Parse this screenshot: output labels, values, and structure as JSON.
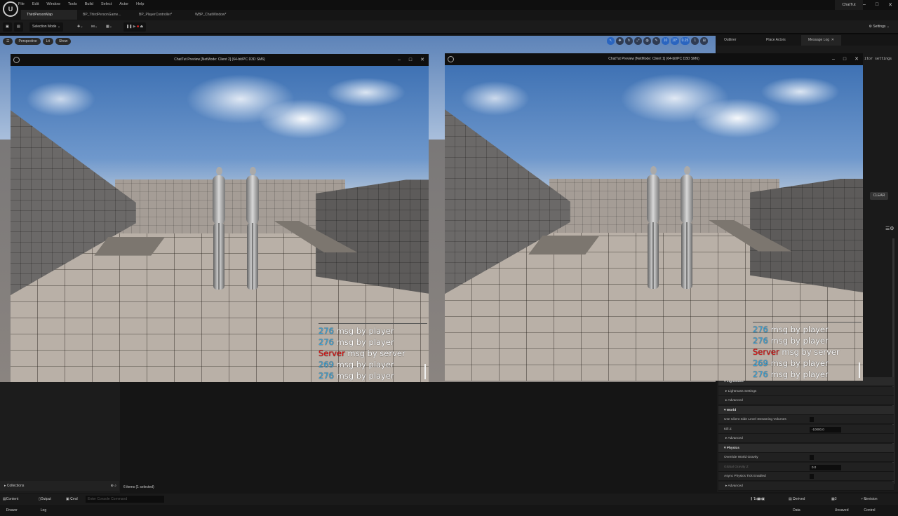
{
  "app": {
    "title": "ChatTut",
    "logo": "U"
  },
  "menu": [
    "File",
    "Edit",
    "Window",
    "Tools",
    "Build",
    "Select",
    "Actor",
    "Help"
  ],
  "tabs": [
    {
      "label": "ThirdPersonMap"
    },
    {
      "label": "BP_ThirdPersonGame..."
    },
    {
      "label": "BP_PlayerController*"
    },
    {
      "label": "WBP_ChatWindow*"
    }
  ],
  "toolbar": {
    "selection_mode": "Selection Mode",
    "settings": "Settings"
  },
  "viewport": {
    "view": "Perspective",
    "lit": "Lit",
    "show": "Show",
    "grid": "10",
    "angle": "10°",
    "scale": "0.25",
    "camera": "1"
  },
  "right_tabs": [
    "Outliner",
    "Place Actors",
    "Message Log"
  ],
  "right_panel": {
    "editor_settings": "itor settings",
    "clear": "CLEAR",
    "rows": [
      {
        "label": "Lightmass",
        "type": "cat"
      },
      {
        "label": "Lightmass Settings",
        "type": "sub"
      },
      {
        "label": "Advanced",
        "type": "sub"
      },
      {
        "label": "World",
        "type": "cat"
      },
      {
        "label": "Use Client Side Level Streaming Volumes",
        "type": "check"
      },
      {
        "label": "Kill Z",
        "type": "value",
        "value": "-10000.0"
      },
      {
        "label": "Advanced",
        "type": "sub"
      },
      {
        "label": "Physics",
        "type": "cat"
      },
      {
        "label": "Override World Gravity",
        "type": "check"
      },
      {
        "label": "Global Gravity Z",
        "type": "value",
        "value": "0.0",
        "disabled": true
      },
      {
        "label": "Async Physics Tick Enabled",
        "type": "check"
      },
      {
        "label": "Advanced",
        "type": "sub"
      }
    ]
  },
  "preview_windows": [
    {
      "title": "ChatTut Preview [NetMode: Client 2]  (64-bit/PC D3D SM6)"
    },
    {
      "title": "ChatTut Preview [NetMode: Client 1]  (64-bit/PC D3D SM6)"
    }
  ],
  "chat": [
    {
      "name": "276",
      "msg": "msg by player",
      "kind": "player"
    },
    {
      "name": "276",
      "msg": "msg by player",
      "kind": "player"
    },
    {
      "name": "Server",
      "msg": "msg by server",
      "kind": "server"
    },
    {
      "name": "269",
      "msg": "msg by player",
      "kind": "player"
    },
    {
      "name": "276",
      "msg": "msg by player",
      "kind": "player"
    }
  ],
  "content_browser": {
    "collections": "Collections",
    "items": "6 items (1 selected)"
  },
  "statusbar": {
    "content_drawer": "Content Drawer",
    "output_log": "Output Log",
    "cmd": "Cmd",
    "console_placeholder": "Enter Console Command",
    "trace": "Trace",
    "derived_data": "Derived Data",
    "unsaved": "3 Unsaved",
    "revision_control": "Revision Control"
  }
}
